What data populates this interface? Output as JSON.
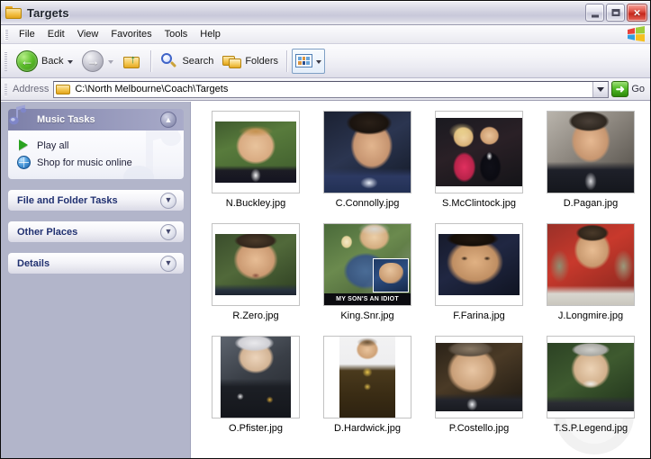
{
  "window": {
    "title": "Targets",
    "icon": "folder-icon",
    "controls": {
      "minimize": "–",
      "maximize": "□",
      "close": "×"
    }
  },
  "menubar": {
    "items": [
      {
        "label": "File"
      },
      {
        "label": "Edit"
      },
      {
        "label": "View"
      },
      {
        "label": "Favorites"
      },
      {
        "label": "Tools"
      },
      {
        "label": "Help"
      }
    ],
    "logo": "windows-flag-icon"
  },
  "toolbar": {
    "back_label": "Back",
    "forward_label": "",
    "up_label": "",
    "search_label": "Search",
    "folders_label": "Folders",
    "views_label": ""
  },
  "address": {
    "label": "Address",
    "path": "C:\\North Melbourne\\Coach\\Targets",
    "go_label": "Go"
  },
  "sidebar": {
    "panels": [
      {
        "title": "Music Tasks",
        "state": "expanded",
        "chevron": "▲",
        "tasks": [
          {
            "label": "Play all",
            "icon": "play-icon"
          },
          {
            "label": "Shop for music online",
            "icon": "globe-icon"
          }
        ]
      },
      {
        "title": "File and Folder Tasks",
        "state": "collapsed",
        "chevron": "▼"
      },
      {
        "title": "Other Places",
        "state": "collapsed",
        "chevron": "▼"
      },
      {
        "title": "Details",
        "state": "collapsed",
        "chevron": "▼"
      }
    ]
  },
  "files": [
    {
      "name": "N.Buckley.jpg"
    },
    {
      "name": "C.Connolly.jpg"
    },
    {
      "name": "S.McClintock.jpg"
    },
    {
      "name": "D.Pagan.jpg"
    },
    {
      "name": "R.Zero.jpg"
    },
    {
      "name": "King.Snr.jpg",
      "caption": "MY SON'S AN IDIOT"
    },
    {
      "name": "F.Farina.jpg"
    },
    {
      "name": "J.Longmire.jpg"
    },
    {
      "name": "O.Pfister.jpg"
    },
    {
      "name": "D.Hardwick.jpg"
    },
    {
      "name": "P.Costello.jpg"
    },
    {
      "name": "T.S.P.Legend.jpg"
    }
  ],
  "colors": {
    "titlebar": "#d2d2e0",
    "sidebar_bg": "#b2b5ca",
    "panel_header": "#8e91b6",
    "accent_green": "#52ba28",
    "accent_red": "#c5281c"
  }
}
